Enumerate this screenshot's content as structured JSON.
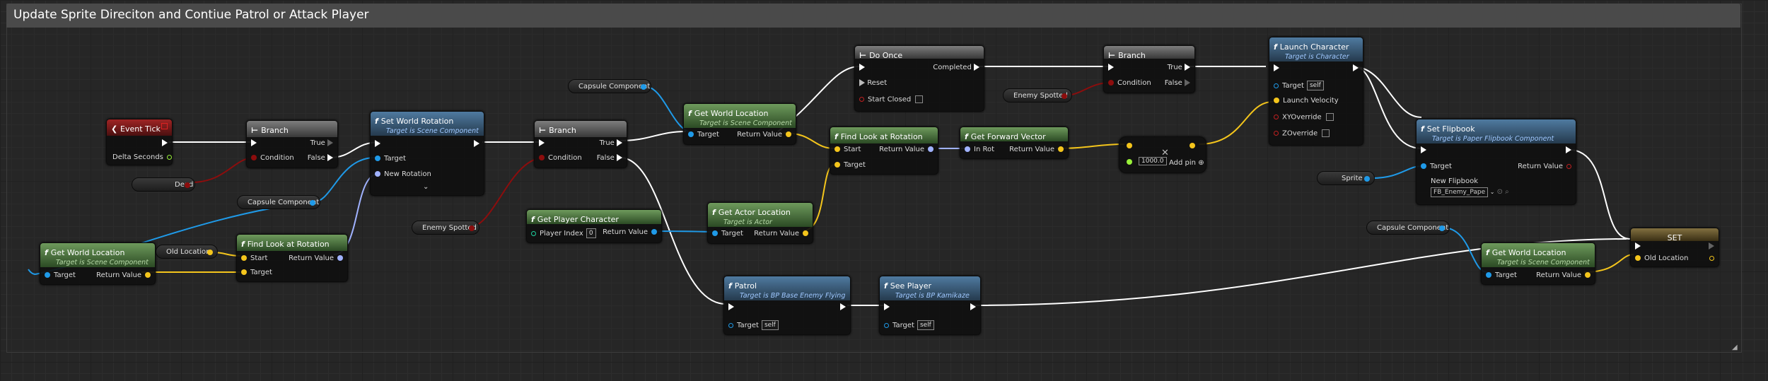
{
  "comment": {
    "title": "Update Sprite Direciton and Contiue Patrol or Attack Player"
  },
  "event_tick": {
    "title": "Event Tick",
    "delta": "Delta Seconds"
  },
  "branch1": {
    "title": "Branch",
    "condition": "Condition",
    "true": "True",
    "false": "False"
  },
  "branch2": {
    "title": "Branch",
    "condition": "Condition",
    "true": "True",
    "false": "False"
  },
  "branch3": {
    "title": "Branch",
    "condition": "Condition",
    "true": "True",
    "false": "False"
  },
  "vars": {
    "dead": "Dead",
    "capsule1": "Capsule Component",
    "capsule2": "Capsule Component",
    "capsule3": "Capsule Component",
    "enemy_spotted1": "Enemy Spotted",
    "enemy_spotted2": "Enemy Spotted",
    "old_location": "Old Location",
    "sprite": "Sprite"
  },
  "set_world_rotation": {
    "title": "Set World Rotation",
    "subtitle": "Target is Scene Component",
    "target": "Target",
    "new_rotation": "New Rotation"
  },
  "get_world_location1": {
    "title": "Get World Location",
    "subtitle": "Target is Scene Component",
    "target": "Target",
    "ret": "Return Value"
  },
  "get_world_location2": {
    "title": "Get World Location",
    "subtitle": "Target is Scene Component",
    "target": "Target",
    "ret": "Return Value"
  },
  "get_world_location3": {
    "title": "Get World Location",
    "subtitle": "Target is Scene Component",
    "target": "Target",
    "ret": "Return Value"
  },
  "find_look1": {
    "title": "Find Look at Rotation",
    "start": "Start",
    "target": "Target",
    "ret": "Return Value"
  },
  "find_look2": {
    "title": "Find Look at Rotation",
    "start": "Start",
    "target": "Target",
    "ret": "Return Value"
  },
  "get_player": {
    "title": "Get Player Character",
    "index_label": "Player Index",
    "index_value": "0",
    "ret": "Return Value"
  },
  "get_actor_loc": {
    "title": "Get Actor Location",
    "subtitle": "Target is Actor",
    "target": "Target",
    "ret": "Return Value"
  },
  "do_once": {
    "title": "Do Once",
    "completed": "Completed",
    "reset": "Reset",
    "start_closed": "Start Closed"
  },
  "get_forward": {
    "title": "Get Forward Vector",
    "in_rot": "In Rot",
    "ret": "Return Value"
  },
  "multiply": {
    "value": "1000.0",
    "add_pin": "Add pin"
  },
  "launch": {
    "title": "Launch Character",
    "subtitle": "Target is Character",
    "target": "Target",
    "target_value": "self",
    "velocity": "Launch Velocity",
    "xy": "XYOverride",
    "z": "ZOverride"
  },
  "set_flipbook": {
    "title": "Set Flipbook",
    "subtitle": "Target is Paper Flipbook Component",
    "target": "Target",
    "new_flipbook": "New Flipbook",
    "flipbook_value": "FB_Enemy_Pape",
    "ret": "Return Value"
  },
  "patrol": {
    "title": "Patrol",
    "subtitle": "Target is BP Base Enemy Flying",
    "target": "Target",
    "target_value": "self"
  },
  "see_player": {
    "title": "See Player",
    "subtitle": "Target is BP Kamikaze",
    "target": "Target",
    "target_value": "self"
  },
  "set_node": {
    "title": "SET",
    "old_location": "Old Location"
  },
  "colors": {
    "exec": "#ffffff",
    "object": "#1f9ae8",
    "vector": "#f4c51c",
    "rotator": "#a0b2ff",
    "bool": "#8c0d0d",
    "int": "#1ed4a0"
  }
}
